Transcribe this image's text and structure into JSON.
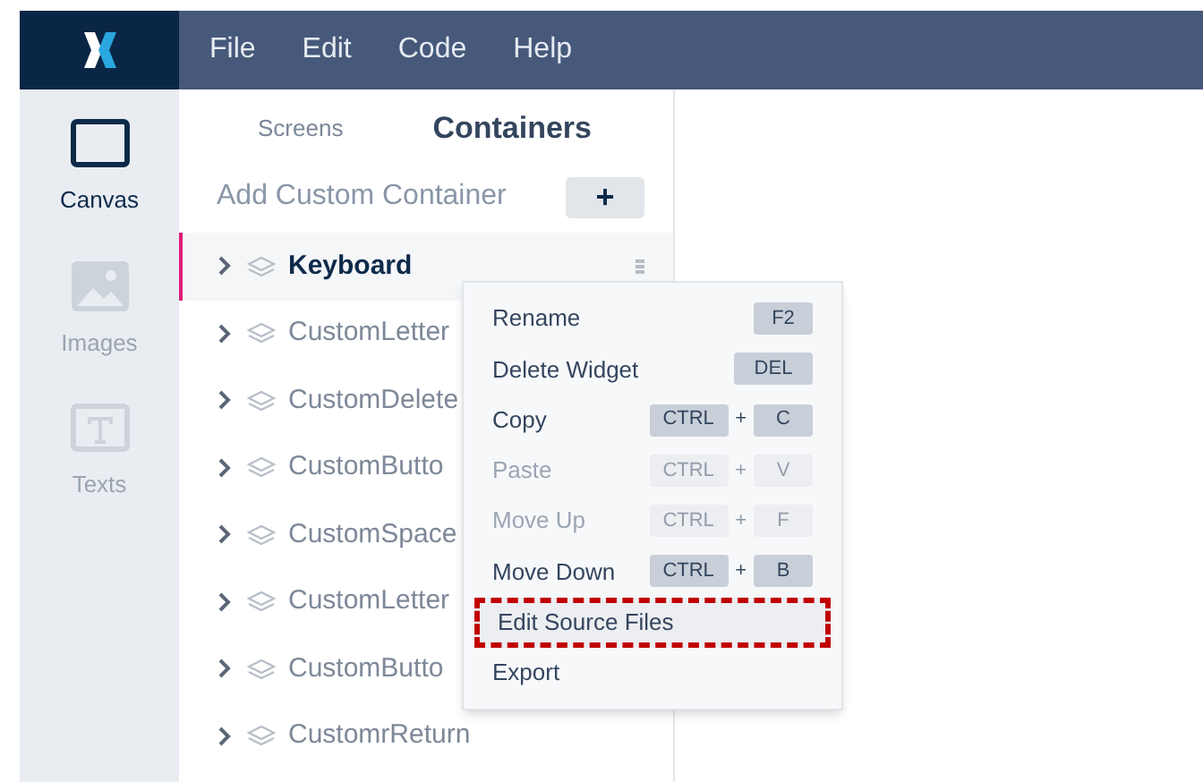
{
  "menu_bar": {
    "items": [
      "File",
      "Edit",
      "Code",
      "Help"
    ]
  },
  "rail": [
    {
      "label": "Canvas",
      "kind": "canvas",
      "selected": true
    },
    {
      "label": "Images",
      "kind": "images",
      "selected": false
    },
    {
      "label": "Texts",
      "kind": "texts",
      "selected": false
    }
  ],
  "panel_tabs": [
    {
      "label": "Screens",
      "selected": false
    },
    {
      "label": "Containers",
      "selected": true
    }
  ],
  "add_container": {
    "label": "Add Custom Container",
    "button": "+"
  },
  "tree": [
    {
      "label": "Keyboard",
      "selected": true
    },
    {
      "label": "CustomLetter",
      "selected": false
    },
    {
      "label": "CustomDelete",
      "selected": false
    },
    {
      "label": "CustomButto",
      "selected": false
    },
    {
      "label": "CustomSpace",
      "selected": false
    },
    {
      "label": "CustomLetter",
      "selected": false
    },
    {
      "label": "CustomButto",
      "selected": false
    },
    {
      "label": "CustomrReturn",
      "selected": false
    }
  ],
  "context_menu": [
    {
      "label": "Rename",
      "disabled": false,
      "outlined": false,
      "keys": [
        "F2"
      ]
    },
    {
      "label": "Delete Widget",
      "disabled": false,
      "outlined": false,
      "keys": [
        "DEL"
      ]
    },
    {
      "label": "Copy",
      "disabled": false,
      "outlined": false,
      "keys": [
        "CTRL",
        "C"
      ],
      "joiner": "+"
    },
    {
      "label": "Paste",
      "disabled": true,
      "outlined": false,
      "keys": [
        "CTRL",
        "V"
      ],
      "joiner": "+"
    },
    {
      "label": "Move Up",
      "disabled": true,
      "outlined": false,
      "keys": [
        "CTRL",
        "F"
      ],
      "joiner": "+"
    },
    {
      "label": "Move Down",
      "disabled": false,
      "outlined": false,
      "keys": [
        "CTRL",
        "B"
      ],
      "joiner": "+"
    },
    {
      "label": "Edit Source Files",
      "disabled": false,
      "outlined": true
    },
    {
      "label": "Export",
      "disabled": false,
      "outlined": false
    }
  ]
}
